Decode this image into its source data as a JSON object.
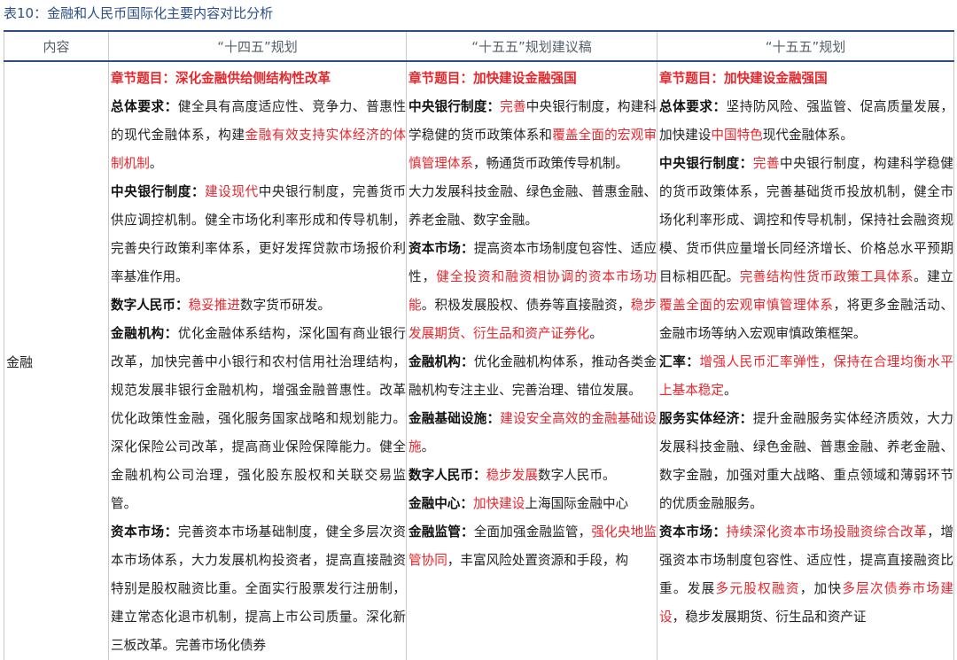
{
  "caption": "表10：金融和人民币国际化主要内容对比分析",
  "headers": [
    "内容",
    "“十四五”规划",
    "“十五五”规划建议稿",
    "“十五五”规划"
  ],
  "row_label": "金融",
  "col1": [
    [
      {
        "t": "章节题目：深化金融供给侧结构性改革",
        "s": "rb"
      }
    ],
    [
      {
        "t": "总体要求：",
        "s": "b"
      },
      {
        "t": "健全具有高度适应性、竞争力、普惠性的现代金融体系，构建",
        "s": ""
      },
      {
        "t": "金融有效支持实体经济的体制机制",
        "s": "r"
      },
      {
        "t": "。",
        "s": ""
      }
    ],
    [
      {
        "t": "中央银行制度：",
        "s": "b"
      },
      {
        "t": "建设现代",
        "s": "r"
      },
      {
        "t": "中央银行制度，完善货币供应调控机制。健全市场化利率形成和传导机制，完善央行政策利率体系，更好发挥贷款市场报价利率基准作用。",
        "s": ""
      }
    ],
    [
      {
        "t": "数字人民币：",
        "s": "b"
      },
      {
        "t": "稳妥推进",
        "s": "r"
      },
      {
        "t": "数字货币研发。",
        "s": ""
      }
    ],
    [
      {
        "t": "金融机构：",
        "s": "b"
      },
      {
        "t": "优化金融体系结构，深化国有商业银行改革，加快完善中小银行和农村信用社治理结构，规范发展非银行金融机构，增强金融普惠性。改革优化政策性金融，强化服务国家战略和规划能力。深化保险公司改革，提高商业保险保障能力。健全金融机构公司治理，强化股东股权和关联交易监管。",
        "s": ""
      }
    ],
    [
      {
        "t": "资本市场：",
        "s": "b"
      },
      {
        "t": "完善资本市场基础制度，健全多层次资本市场体系，大力发展机构投资者，提高直接融资特别是股权融资比重。全面实行股票发行注册制，建立常态化退市机制，提高上市公司质量。深化新三板改革。完善市场化债券",
        "s": ""
      }
    ]
  ],
  "col2": [
    [
      {
        "t": "章节题目：加快建设金融强国",
        "s": "rb"
      }
    ],
    [
      {
        "t": "中央银行制度：",
        "s": "b"
      },
      {
        "t": "完善",
        "s": "r"
      },
      {
        "t": "中央银行制度，构建科学稳健的货币政策体系和",
        "s": ""
      },
      {
        "t": "覆盖全面的宏观审慎管理体系",
        "s": "r"
      },
      {
        "t": "，畅通货币政策传导机制。",
        "s": ""
      }
    ],
    [
      {
        "t": "大力发展科技金融、绿色金融、普惠金融、养老金融、数字金融。",
        "s": ""
      }
    ],
    [
      {
        "t": "资本市场：",
        "s": "b"
      },
      {
        "t": "提高资本市场制度包容性、适应性，",
        "s": ""
      },
      {
        "t": "健全投资和融资相协调的资本市场功能",
        "s": "r"
      },
      {
        "t": "。积极发展股权、债券等直接融资，",
        "s": ""
      },
      {
        "t": "稳步发展期货、衍生品和资产证券化",
        "s": "r"
      },
      {
        "t": "。",
        "s": ""
      }
    ],
    [
      {
        "t": "金融机构：",
        "s": "b"
      },
      {
        "t": "优化金融机构体系，推动各类金融机构专注主业、完善治理、错位发展。",
        "s": ""
      }
    ],
    [
      {
        "t": "金融基础设施：",
        "s": "b"
      },
      {
        "t": "建设安全高效的金融基础设施",
        "s": "r"
      },
      {
        "t": "。",
        "s": ""
      }
    ],
    [
      {
        "t": "数字人民币：",
        "s": "b"
      },
      {
        "t": "稳步发展",
        "s": "r"
      },
      {
        "t": "数字人民币。",
        "s": ""
      }
    ],
    [
      {
        "t": "金融中心：",
        "s": "b"
      },
      {
        "t": "加快建设",
        "s": "r"
      },
      {
        "t": "上海国际金融中心",
        "s": ""
      }
    ],
    [
      {
        "t": "金融监管：",
        "s": "b"
      },
      {
        "t": "全面加强金融监管，",
        "s": ""
      },
      {
        "t": "强化央地监管协同",
        "s": "r"
      },
      {
        "t": "，丰富风险处置资源和手段，构",
        "s": ""
      }
    ]
  ],
  "col3": [
    [
      {
        "t": "章节题目：加快建设金融强国",
        "s": "rb"
      }
    ],
    [
      {
        "t": "总体要求：",
        "s": "b"
      },
      {
        "t": "坚持防风险、强监管、促高质量发展，加快建设",
        "s": ""
      },
      {
        "t": "中国特色",
        "s": "r"
      },
      {
        "t": "现代金融体系。",
        "s": ""
      }
    ],
    [
      {
        "t": "中央银行制度：",
        "s": "b"
      },
      {
        "t": "完善",
        "s": "r"
      },
      {
        "t": "中央银行制度，构建科学稳健的货币政策体系，完善基础货币投放机制，健全市场化利率形成、调控和传导机制，保持社会融资规模、货币供应量增长同经济增长、价格总水平预期目标相匹配。",
        "s": ""
      },
      {
        "t": "完善结构性货币政策工具体系",
        "s": "r"
      },
      {
        "t": "。建立",
        "s": ""
      },
      {
        "t": "覆盖全面的宏观审慎管理体系",
        "s": "r"
      },
      {
        "t": "，将更多金融活动、金融市场等纳入宏观审慎政策框架。",
        "s": ""
      }
    ],
    [
      {
        "t": "汇率：",
        "s": "b"
      },
      {
        "t": "增强人民币汇率弹性，保持在合理均衡水平上基本稳定",
        "s": "r"
      },
      {
        "t": "。",
        "s": ""
      }
    ],
    [
      {
        "t": "服务实体经济：",
        "s": "b"
      },
      {
        "t": "提升金融服务实体经济质效，大力发展科技金融、绿色金融、普惠金融、养老金融、数字金融，加强对重大战略、重点领域和薄弱环节的优质金融服务。",
        "s": ""
      }
    ],
    [
      {
        "t": "资本市场：",
        "s": "b"
      },
      {
        "t": "持续深化资本市场投融资综合改革",
        "s": "r"
      },
      {
        "t": "，增强资本市场制度包容性、适应性，提高直接融资比重。发展",
        "s": ""
      },
      {
        "t": "多元股权融资",
        "s": "r"
      },
      {
        "t": "，加快",
        "s": ""
      },
      {
        "t": "多层次债券市场建设",
        "s": "r"
      },
      {
        "t": "，稳步发展期货、衍生品和资产证",
        "s": ""
      }
    ]
  ]
}
